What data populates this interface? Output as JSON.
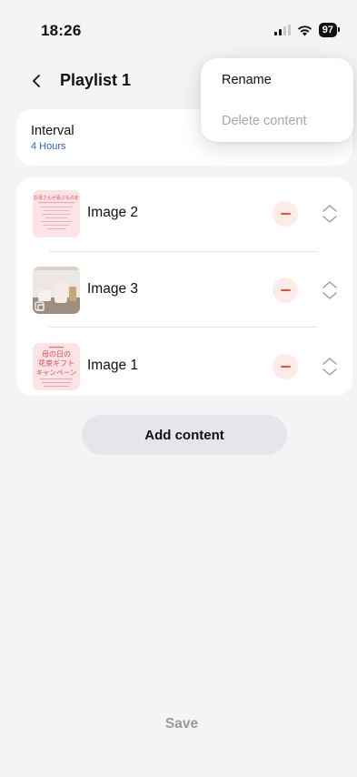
{
  "status_bar": {
    "time": "18:26",
    "battery": "97"
  },
  "header": {
    "title": "Playlist 1"
  },
  "interval": {
    "label": "Interval",
    "value": "4 Hours"
  },
  "items": [
    {
      "label": "Image 2"
    },
    {
      "label": "Image 3"
    },
    {
      "label": "Image 1"
    }
  ],
  "thumb_text": {
    "image1_line1": "母の日の",
    "image1_line2": "花束ギフト",
    "image1_line3": "キャンペーン",
    "image2_title": "お母さんが喜ぶものを"
  },
  "add_content": {
    "label": "Add content"
  },
  "save": {
    "label": "Save"
  },
  "menu": {
    "rename": "Rename",
    "delete": "Delete content"
  },
  "colors": {
    "background": "#f4f4f6",
    "accent_blue": "#2f5fd0",
    "remove_red": "#e6513b",
    "remove_bg": "#fdebe8"
  }
}
